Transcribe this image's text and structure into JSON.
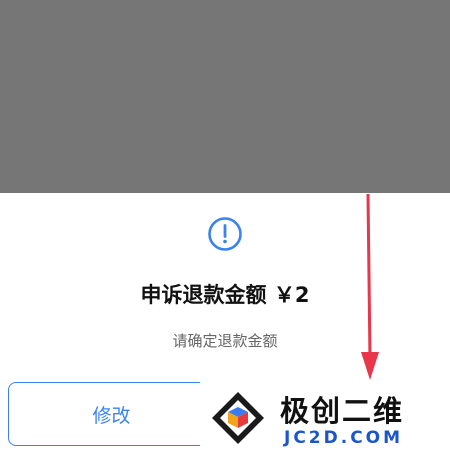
{
  "dialog": {
    "title": "申诉退款金额 ￥2",
    "subtitle": "请确定退款金额",
    "icon": "alert-circle-icon",
    "modify_label": "修改",
    "accent_color": "#3b82f0"
  },
  "watermark": {
    "brand": "极创二维",
    "site": "JC2D.COM"
  }
}
